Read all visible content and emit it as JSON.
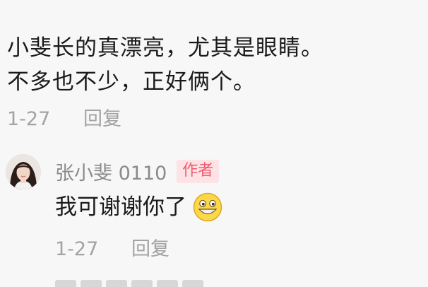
{
  "comment": {
    "lines": [
      "小斐长的真漂亮，尤其是眼睛。",
      "不多也不少，正好俩个。"
    ],
    "date": "1-27",
    "reply_label": "回复"
  },
  "reply": {
    "username": "张小斐 0110",
    "badge": "作者",
    "text": "我可谢谢你了",
    "emoji_icon": "grinning-face-icon",
    "date": "1-27",
    "reply_label": "回复"
  },
  "colors": {
    "background": "#f7f7f7",
    "text": "#1a1a1a",
    "meta": "#a3a3a3",
    "badge_text": "#f25a6e",
    "badge_bg": "#fde3e6"
  }
}
